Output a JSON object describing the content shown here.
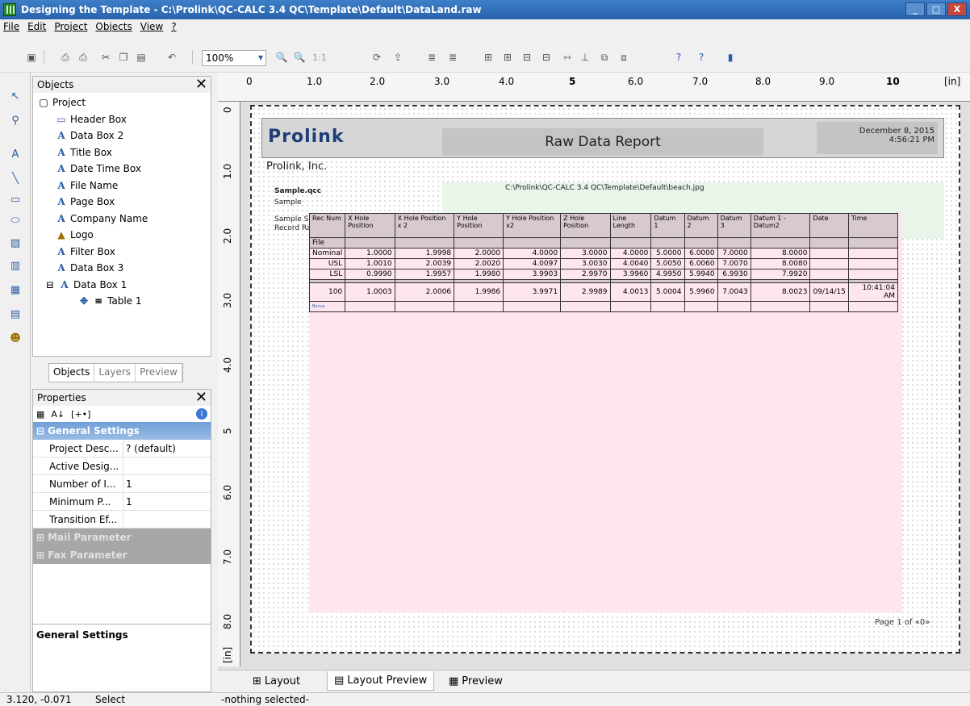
{
  "window": {
    "title": "Designing the Template - C:\\Prolink\\QC-CALC 3.4 QC\\Template\\Default\\DataLand.raw",
    "buttons": [
      "_",
      "□",
      "X"
    ]
  },
  "menu": [
    "File",
    "Edit",
    "Project",
    "Objects",
    "View",
    "?"
  ],
  "toolbar": {
    "zoom": "100%",
    "zoom_reset": "1:1"
  },
  "objects_panel": {
    "title": "Objects",
    "close": "✕",
    "items": [
      "Project",
      "Header Box",
      "Data Box 2",
      "Title Box",
      "Date Time Box",
      "File Name",
      "Page Box",
      "Company Name",
      "Logo",
      "Filter Box",
      "Data Box 3",
      "Data Box 1",
      "Table 1"
    ],
    "tabs": [
      "Objects",
      "Layers",
      "Preview"
    ]
  },
  "properties_panel": {
    "title": "Properties",
    "close": "✕",
    "plus": "[+•]",
    "categories": {
      "general": "General Settings",
      "mail": "Mail Parameter",
      "fax": "Fax Parameter"
    },
    "rows": [
      {
        "k": "Project Desc...",
        "v": "? (default)"
      },
      {
        "k": "Active Desig...",
        "v": ""
      },
      {
        "k": "Number of I...",
        "v": "1"
      },
      {
        "k": "Minimum P...",
        "v": "1"
      },
      {
        "k": "Transition Ef...",
        "v": ""
      }
    ],
    "description_title": "General Settings"
  },
  "ruler": {
    "h": [
      "0",
      "1.0",
      "2.0",
      "3.0",
      "4.0",
      "5",
      "6.0",
      "7.0",
      "8.0",
      "9.0",
      "10",
      "[in]"
    ],
    "v": [
      "0",
      "1.0",
      "2.0",
      "3.0",
      "4.0",
      "5",
      "6.0",
      "7.0",
      "8.0",
      "[in]"
    ]
  },
  "report": {
    "logo": "Prolink",
    "title": "Raw Data Report",
    "date": "December 8, 2015",
    "time": "4:56:21 PM",
    "company": "Prolink, Inc.",
    "file": "Sample.qcc",
    "sample1": "Sample",
    "sample2": "Sample S",
    "record": "Record Ra",
    "image_path": "C:\\Prolink\\QC-CALC 3.4 QC\\Template\\Default\\beach.jpg",
    "page": "Page 1 of «0»"
  },
  "table": {
    "headers": [
      "Rec Num",
      "X Hole Position",
      "X Hole Position x 2",
      "Y Hole Position",
      "Y Hole Position x2",
      "Z Hole Position",
      "Line Length",
      "Datum 1",
      "Datum 2",
      "Datum 3",
      "Datum 1 - Datum2",
      "Date",
      "Time"
    ],
    "file_label": "File",
    "rows": [
      [
        "Nominal",
        "1.0000",
        "1.9998",
        "2.0000",
        "4.0000",
        "3.0000",
        "4.0000",
        "5.0000",
        "6.0000",
        "7.0000",
        "8.0000",
        "",
        ""
      ],
      [
        "USL",
        "1.0010",
        "2.0039",
        "2.0020",
        "4.0097",
        "3.0030",
        "4.0040",
        "5.0050",
        "6.0060",
        "7.0070",
        "8.0080",
        "",
        ""
      ],
      [
        "LSL",
        "0.9990",
        "1.9957",
        "1.9980",
        "3.9903",
        "2.9970",
        "3.9960",
        "4.9950",
        "5.9940",
        "6.9930",
        "7.9920",
        "",
        ""
      ],
      [
        "100",
        "1.0003",
        "2.0006",
        "1.9986",
        "3.9971",
        "2.9989",
        "4.0013",
        "5.0004",
        "5.9960",
        "7.0043",
        "8.0023",
        "09/14/15",
        "10:41:04 AM"
      ]
    ],
    "bonus": "Bonus"
  },
  "bottom_tabs": [
    "Layout",
    "Layout Preview",
    "Preview"
  ],
  "status": {
    "coords": "3.120, -0.071",
    "mode": "Select",
    "selection": "-nothing selected-"
  }
}
